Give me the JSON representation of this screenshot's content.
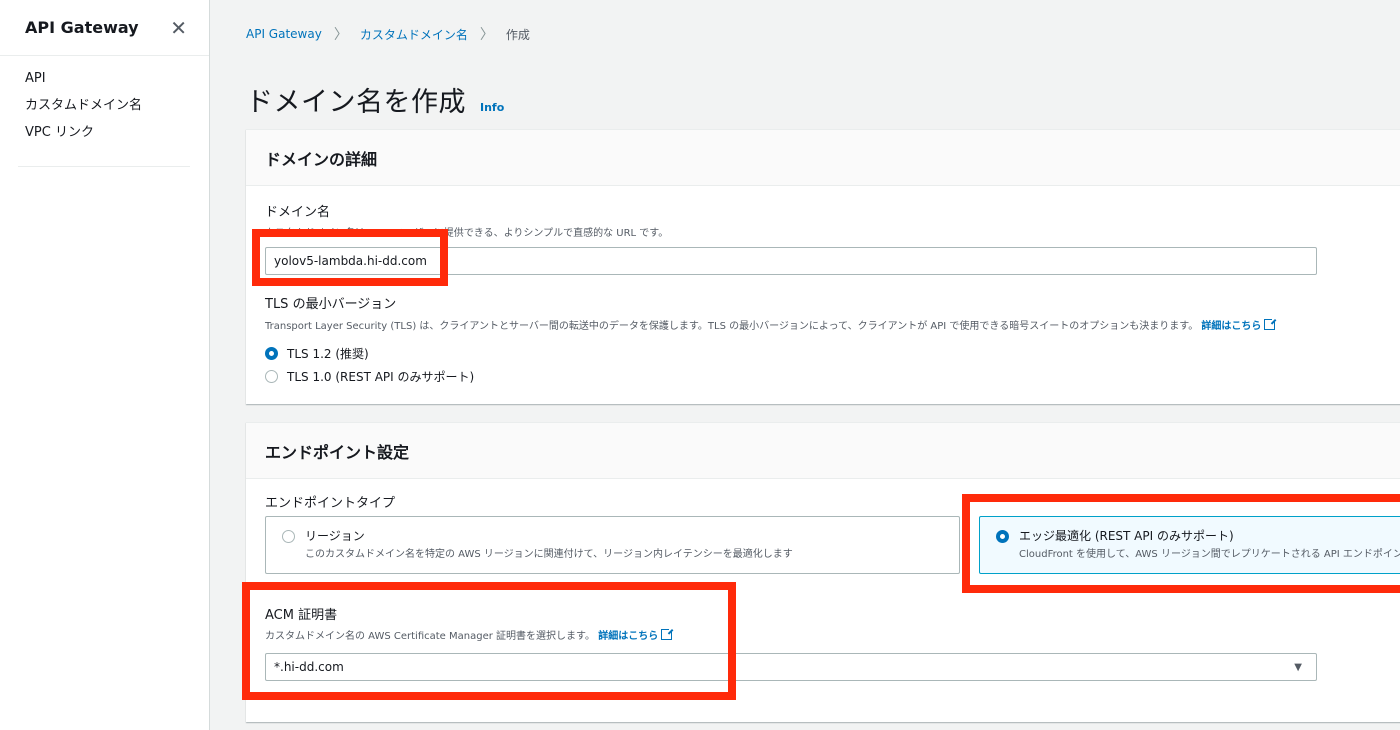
{
  "sidebar": {
    "title": "API Gateway",
    "close_glyph": "✕",
    "items": [
      {
        "label": "API"
      },
      {
        "label": "カスタムドメイン名"
      },
      {
        "label": "VPC リンク"
      }
    ]
  },
  "breadcrumb": {
    "items": [
      "API Gateway",
      "カスタムドメイン名",
      "作成"
    ],
    "separator": "〉"
  },
  "page": {
    "title": "ドメイン名を作成",
    "info": "Info"
  },
  "domain_details": {
    "heading": "ドメインの詳細",
    "domain_name_label": "ドメイン名",
    "domain_name_desc": "カスタムドメイン名は、API ユーザーに提供できる、よりシンプルで直感的な URL です。",
    "domain_name_value": "yolov5-lambda.hi-dd.com",
    "tls_label": "TLS の最小バージョン",
    "tls_desc": "Transport Layer Security (TLS) は、クライアントとサーバー間の転送中のデータを保護します。TLS の最小バージョンによって、クライアントが API で使用できる暗号スイートのオプションも決まります。",
    "learn_more": "詳細はこちら",
    "tls_options": [
      {
        "label": "TLS 1.2 (推奨)",
        "checked": true
      },
      {
        "label": "TLS 1.0 (REST API のみサポート)",
        "checked": false
      }
    ]
  },
  "endpoint": {
    "heading": "エンドポイント設定",
    "type_label": "エンドポイントタイプ",
    "options": [
      {
        "title": "リージョン",
        "desc": "このカスタムドメイン名を特定の AWS リージョンに関連付けて、リージョン内レイテンシーを最適化します",
        "checked": false
      },
      {
        "title": "エッジ最適化 (REST API のみサポート)",
        "desc": "CloudFront を使用して、AWS リージョン間でレプリケートされる API エンドポイントです",
        "checked": true
      }
    ],
    "acm_label": "ACM 証明書",
    "acm_desc": "カスタムドメイン名の AWS Certificate Manager 証明書を選択します。",
    "learn_more": "詳細はこちら",
    "acm_value": "*.hi-dd.com",
    "select_caret": "▼"
  },
  "colors": {
    "highlight": "#ff2a0a",
    "link": "#0073bb",
    "selected_border": "#00a1c9"
  }
}
